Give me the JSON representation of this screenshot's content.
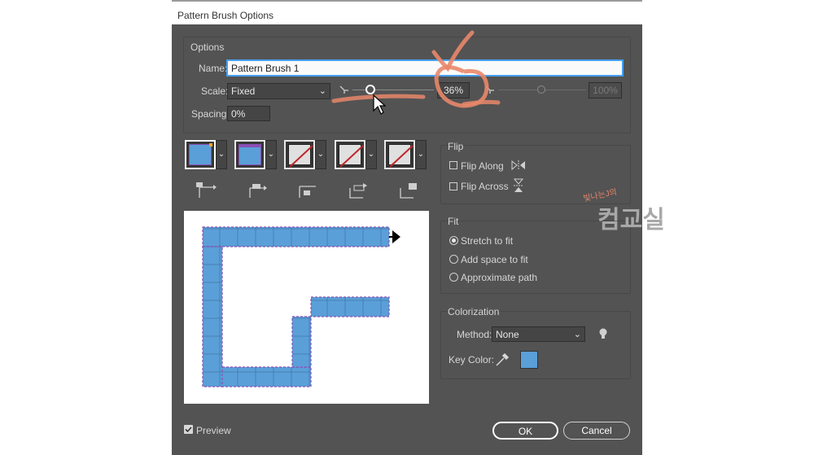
{
  "window": {
    "title": "Pattern Brush Options"
  },
  "options": {
    "group_label": "Options",
    "name_label": "Name:",
    "name_value": "Pattern Brush 1",
    "scale_label": "Scale:",
    "scale_mode": "Fixed",
    "scale_min_value": "36%",
    "scale_max_value": "100%",
    "scale_fraction": 0.36,
    "spacing_label": "Spacing:",
    "spacing_value": "0%"
  },
  "flip": {
    "group_label": "Flip",
    "flip_along_label": "Flip Along",
    "flip_across_label": "Flip Across"
  },
  "fit": {
    "group_label": "Fit",
    "stretch_label": "Stretch to fit",
    "add_space_label": "Add space to fit",
    "approx_label": "Approximate path",
    "selected": "stretch"
  },
  "colorization": {
    "group_label": "Colorization",
    "method_label": "Method:",
    "method_value": "None",
    "key_color_label": "Key Color:",
    "key_color": "#5a9fd8"
  },
  "preview": {
    "label": "Preview",
    "checked": true
  },
  "buttons": {
    "ok": "OK",
    "cancel": "Cancel"
  },
  "watermark": {
    "small": "빛나는J의",
    "large": "컴교실"
  },
  "colors": {
    "dialog_bg": "#535353",
    "tile_fill": "#5a9fd8",
    "tile_border": "#8a4fb3",
    "annotation": "#e8876a"
  }
}
